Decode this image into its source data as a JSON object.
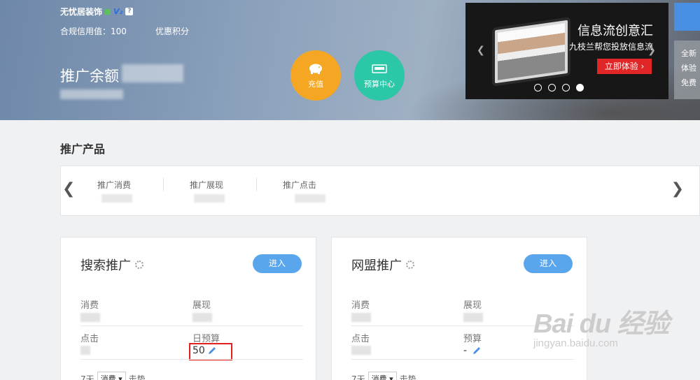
{
  "header": {
    "account_name": "无忧居装饰",
    "vip_level": "V₂",
    "help": "?",
    "credit": "合规信用值：100",
    "points": "优惠积分",
    "balance_label": "推广余额",
    "recharge_label": "充值",
    "budget_center_label": "预算中心"
  },
  "ad": {
    "title": "信息流创意汇",
    "subtitle": "九枝兰帮您投放信息流",
    "button": "立即体验 ›"
  },
  "side_panel": [
    "全新",
    "体验",
    "免费"
  ],
  "section_title": "推广产品",
  "tabs": [
    "推广消费",
    "推广展现",
    "推广点击"
  ],
  "cards": {
    "search": {
      "title": "搜索推广",
      "enter": "进入",
      "spend": "消费",
      "impressions": "展现",
      "clicks": "点击",
      "daily_budget": "日预算",
      "daily_budget_value": "50",
      "trend_days": "7天",
      "trend_select": "消费 ▾",
      "trend_label": "走势"
    },
    "union": {
      "title": "网盟推广",
      "enter": "进入",
      "spend": "消费",
      "impressions": "展现",
      "clicks": "点击",
      "budget": "预算",
      "budget_value": "-",
      "trend_days": "7天",
      "trend_select": "消费 ▾",
      "trend_label": "走势"
    }
  },
  "watermark": {
    "logo": "Bai du 经验",
    "url": "jingyan.baidu.com"
  }
}
